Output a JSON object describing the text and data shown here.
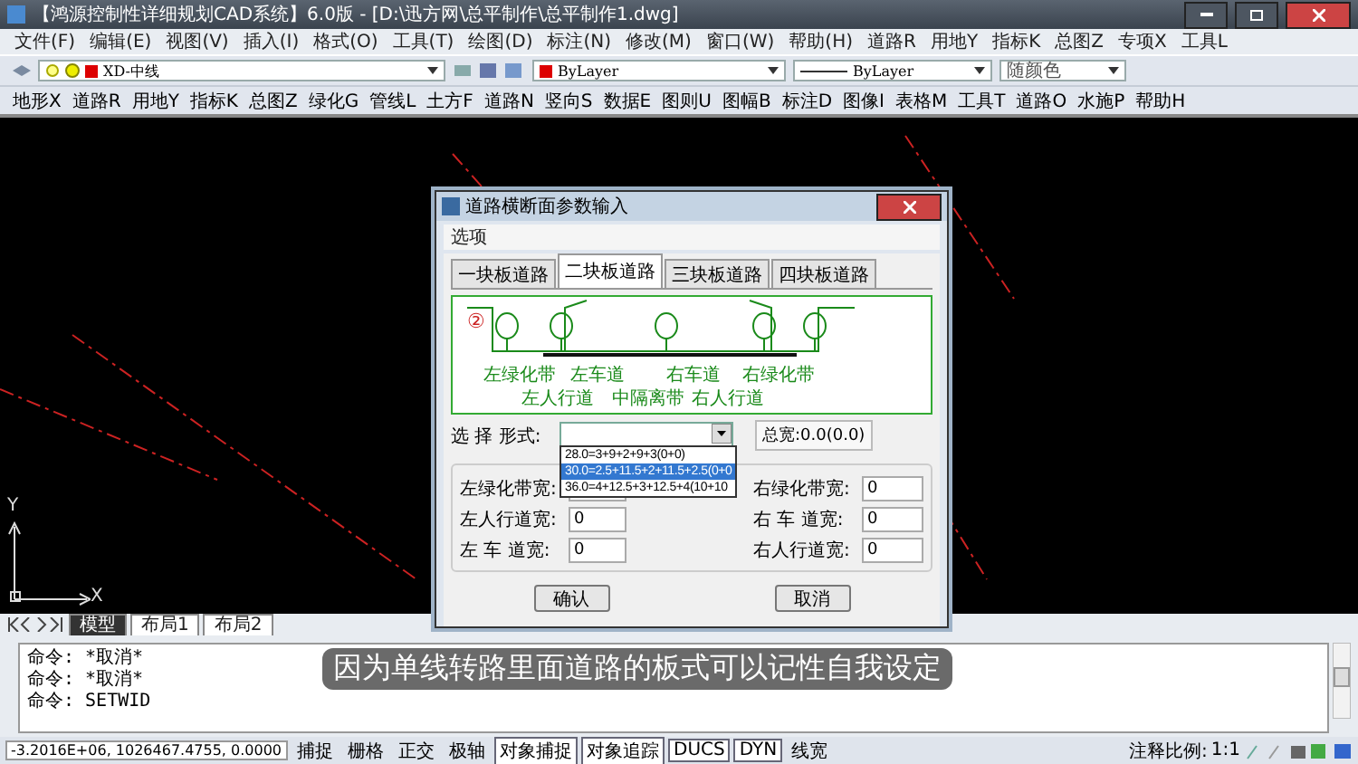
{
  "window": {
    "title": "【鸿源控制性详细规划CAD系统】6.0版 - [D:\\迅方网\\总平制作\\总平制作1.dwg]"
  },
  "menu_bar": [
    "文件(F)",
    "编辑(E)",
    "视图(V)",
    "插入(I)",
    "格式(O)",
    "工具(T)",
    "绘图(D)",
    "标注(N)",
    "修改(M)",
    "窗口(W)",
    "帮助(H)",
    "道路R",
    "用地Y",
    "指标K",
    "总图Z",
    "专项X",
    "工具L"
  ],
  "layer_toolbar": {
    "layer": "XD-中线",
    "color_setting": "ByLayer",
    "linetype": "ByLayer",
    "plot_style": "随颜色"
  },
  "toolbar": [
    "地形X",
    "道路R",
    "用地Y",
    "指标K",
    "总图Z",
    "绿化G",
    "管线L",
    "土方F",
    "道路N",
    "竖向S",
    "数据E",
    "图则U",
    "图幅B",
    "标注D",
    "图像I",
    "表格M",
    "工具T",
    "道路O",
    "水施P",
    "帮助H"
  ],
  "ucs": {
    "y_label": "Y",
    "x_label": "X"
  },
  "layout_tabs": [
    {
      "label": "模型",
      "selected": true
    },
    {
      "label": "布局1",
      "selected": false
    },
    {
      "label": "布局2",
      "selected": false
    }
  ],
  "command_lines": [
    "命令: *取消*",
    "命令: *取消*",
    "命令: SETWID"
  ],
  "caption": "因为单线转路里面道路的板式可以记性自我设定",
  "status_bar": {
    "coordinates": "-3.2016E+06, 1026467.4755, 0.0000",
    "toggles": [
      {
        "label": "捕捉",
        "on": false
      },
      {
        "label": "栅格",
        "on": false
      },
      {
        "label": "正交",
        "on": false
      },
      {
        "label": "极轴",
        "on": false
      },
      {
        "label": "对象捕捉",
        "on": true
      },
      {
        "label": "对象追踪",
        "on": true
      },
      {
        "label": "DUCS",
        "on": true
      },
      {
        "label": "DYN",
        "on": true
      },
      {
        "label": "线宽",
        "on": false
      }
    ],
    "scale_label": "注释比例:",
    "scale": "1:1"
  },
  "dialog": {
    "title": "道路横断面参数输入",
    "menu": [
      "选项"
    ],
    "tabs": [
      {
        "label": "一块板道路",
        "selected": false
      },
      {
        "label": "二块板道路",
        "selected": true
      },
      {
        "label": "三块板道路",
        "selected": false
      },
      {
        "label": "四块板道路",
        "selected": false
      }
    ],
    "diagram": {
      "badge": "②",
      "top_labels": [
        "左绿化带",
        "左车道",
        "右车道",
        "右绿化带"
      ],
      "bottom_labels": [
        "左人行道",
        "中隔离带",
        "右人行道"
      ]
    },
    "form_label": "选 择 形式:",
    "options": [
      {
        "label": "28.0=3+9+2+9+3(0+0)",
        "selected": false
      },
      {
        "label": "30.0=2.5+11.5+2+11.5+2.5(0+0",
        "selected": true
      },
      {
        "label": "36.0=4+12.5+3+12.5+4(10+10",
        "selected": false
      }
    ],
    "total_width": "总宽:0.0(0.0)",
    "fields": [
      {
        "label": "左绿化带宽:"
      },
      {
        "label": "右绿化带宽:",
        "value": "0"
      },
      {
        "label": "左人行道宽:",
        "value": "0"
      },
      {
        "label": "右 车 道宽:",
        "value": "0"
      },
      {
        "label": "左 车 道宽:",
        "value": "0"
      },
      {
        "label": "右人行道宽:",
        "value": "0"
      }
    ],
    "buttons": [
      "确认",
      "取消"
    ]
  }
}
